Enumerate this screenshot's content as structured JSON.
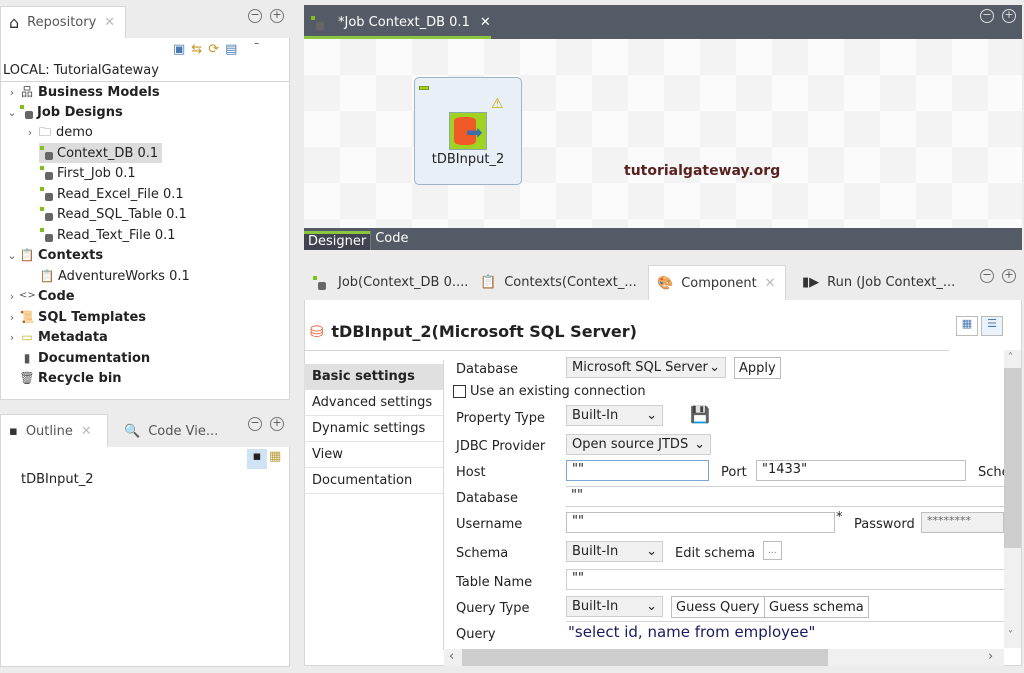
{
  "repository": {
    "tab": "Repository",
    "root": "LOCAL: TutorialGateway",
    "items": [
      {
        "label": "Business Models",
        "bold": true
      },
      {
        "label": "Job Designs",
        "bold": true
      },
      {
        "label": "demo"
      },
      {
        "label": "Context_DB 0.1"
      },
      {
        "label": "First_Job 0.1"
      },
      {
        "label": "Read_Excel_File 0.1"
      },
      {
        "label": "Read_SQL_Table 0.1"
      },
      {
        "label": "Read_Text_File 0.1"
      },
      {
        "label": "Contexts",
        "bold": true
      },
      {
        "label": "AdventureWorks 0.1"
      },
      {
        "label": "Code",
        "bold": true
      },
      {
        "label": "SQL Templates",
        "bold": true
      },
      {
        "label": "Metadata",
        "bold": true
      },
      {
        "label": "Documentation",
        "bold": true
      },
      {
        "label": "Recycle bin",
        "bold": true
      }
    ]
  },
  "outline": {
    "tab": "Outline",
    "tab2": "Code Vie...",
    "item": "tDBInput_2"
  },
  "editor": {
    "tab": "*Job Context_DB 0.1",
    "component": "tDBInput_2",
    "watermark": "tutorialgateway.org",
    "bottom_tabs": [
      "Designer",
      "Code"
    ]
  },
  "bottom": {
    "tabs": [
      "Job(Context_DB 0....",
      "Contexts(Context_...",
      "Component",
      "Run (Job Context_..."
    ],
    "title": "tDBInput_2(Microsoft SQL Server)",
    "nav": [
      "Basic settings",
      "Advanced settings",
      "Dynamic settings",
      "View",
      "Documentation"
    ],
    "form": {
      "database_label": "Database",
      "database_value": "Microsoft SQL Server",
      "apply": "Apply",
      "use_existing": "Use an existing connection",
      "property_type_label": "Property Type",
      "property_type_value": "Built-In",
      "jdbc_label": "JDBC Provider",
      "jdbc_value": "Open source JTDS",
      "host_label": "Host",
      "host_value": "\"\"",
      "port_label": "Port",
      "port_value": "\"1433\"",
      "schema_cut": "Sche",
      "db_label": "Database",
      "db_value": "\"\"",
      "username_label": "Username",
      "username_value": "\"\"",
      "required": "*",
      "password_label": "Password",
      "password_value": "********",
      "schema_label": "Schema",
      "schema_value": "Built-In",
      "edit_schema": "Edit schema",
      "ellipsis": "...",
      "table_label": "Table Name",
      "table_value": "\"\"",
      "query_type_label": "Query Type",
      "query_type_value": "Built-In",
      "guess_query": "Guess Query",
      "guess_schema": "Guess schema",
      "query_label": "Query",
      "query_value": "\"select id, name from employee\""
    }
  },
  "colors": {
    "accent": "#8cc63f",
    "dark": "#545a66"
  }
}
